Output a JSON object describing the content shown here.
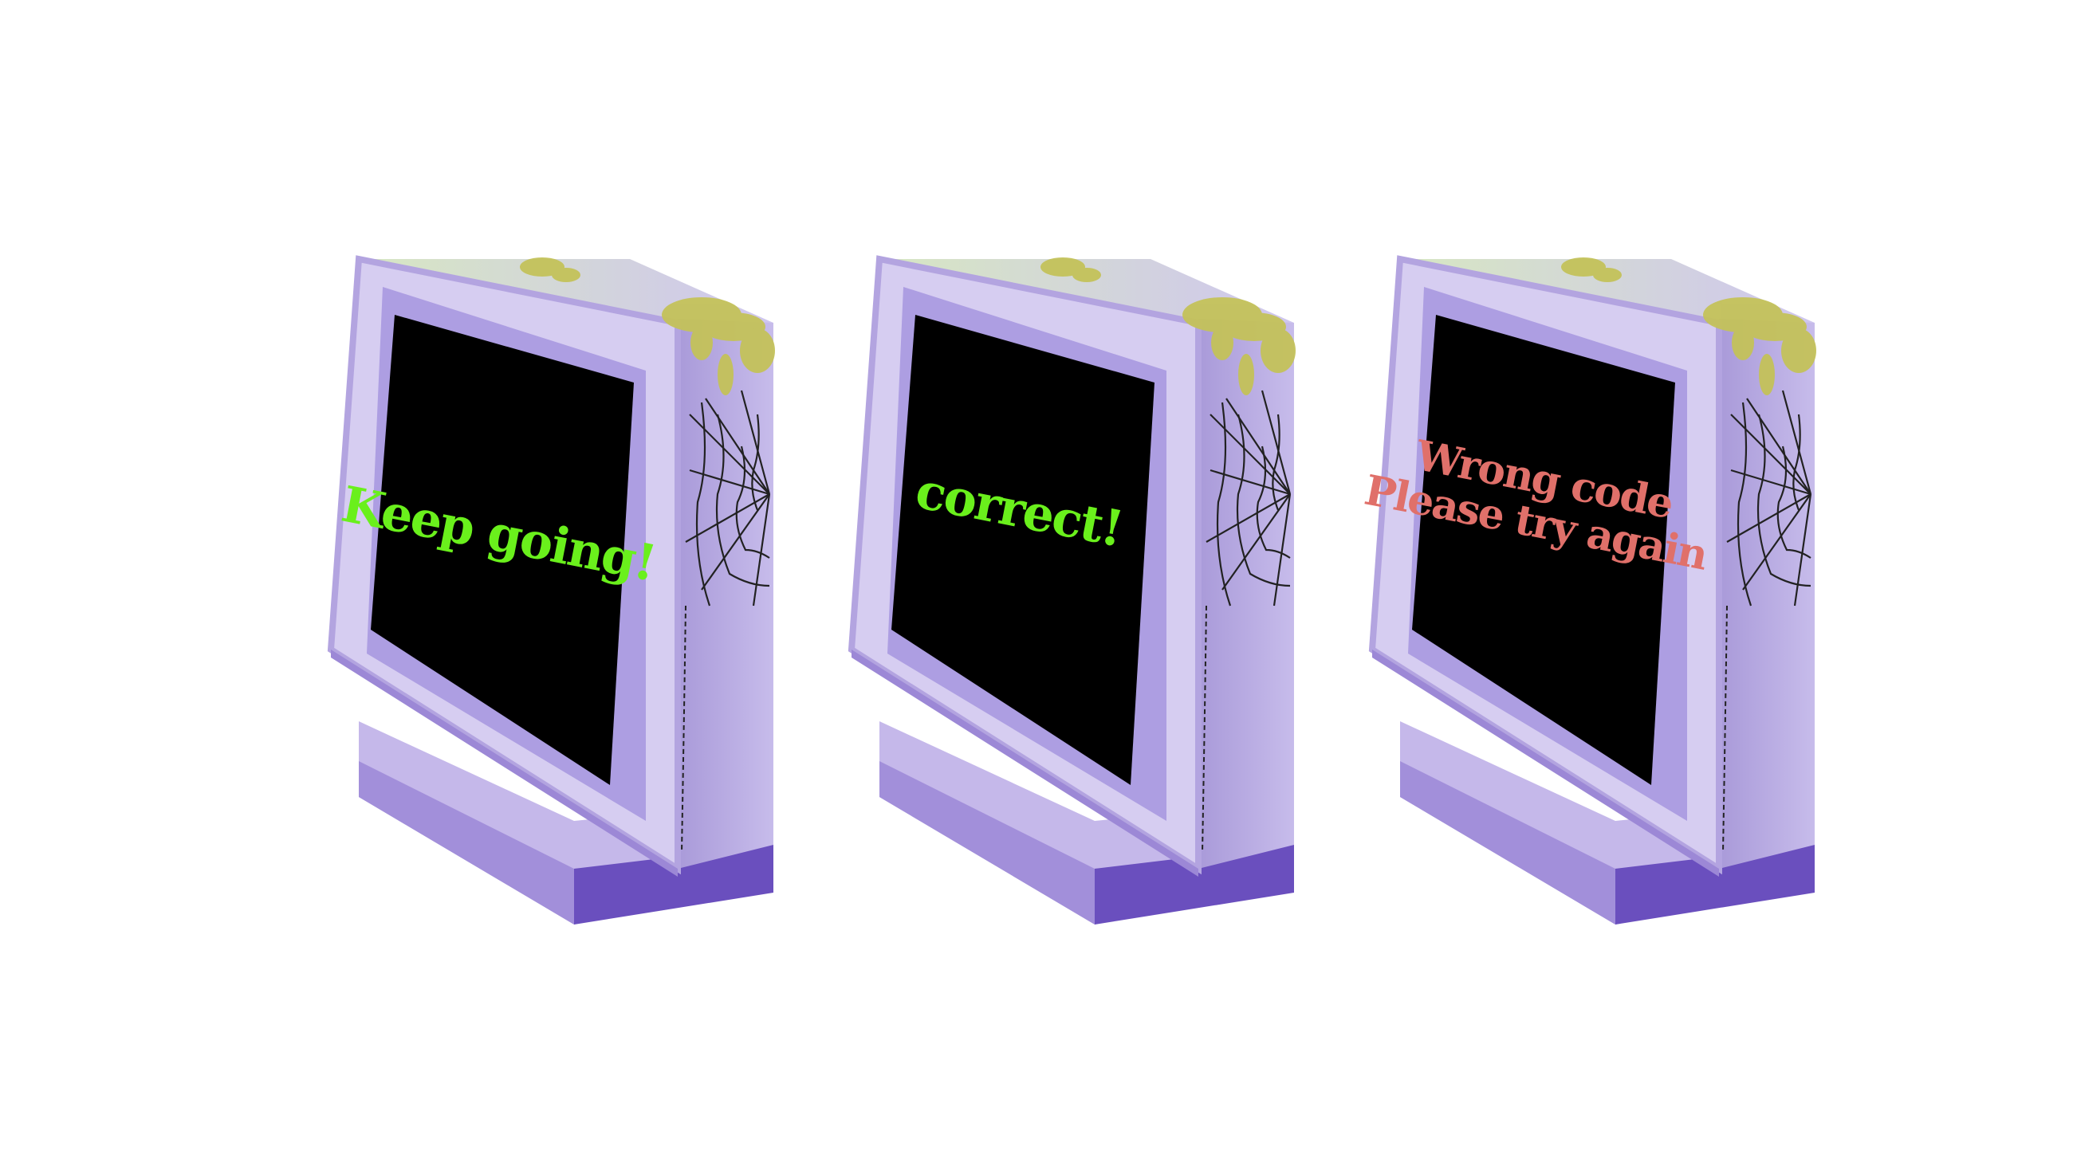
{
  "monitors": [
    {
      "lines": [
        "Keep going!"
      ],
      "text_color": "#6af01c",
      "state": "in-progress"
    },
    {
      "lines": [
        "correct!"
      ],
      "text_color": "#6af01c",
      "state": "success"
    },
    {
      "lines": [
        "Wrong code",
        "Please try again"
      ],
      "text_color": "#e0706a",
      "state": "error"
    }
  ],
  "colors": {
    "casing_light": "#cbc2ea",
    "casing_mid": "#b7a8e2",
    "casing_dark": "#5a3fb0",
    "screen": "#000000",
    "moss": "#c4c25a",
    "web": "#222222"
  },
  "icons": [
    "crt-monitor-icon",
    "cobweb-icon",
    "moss-icon"
  ]
}
